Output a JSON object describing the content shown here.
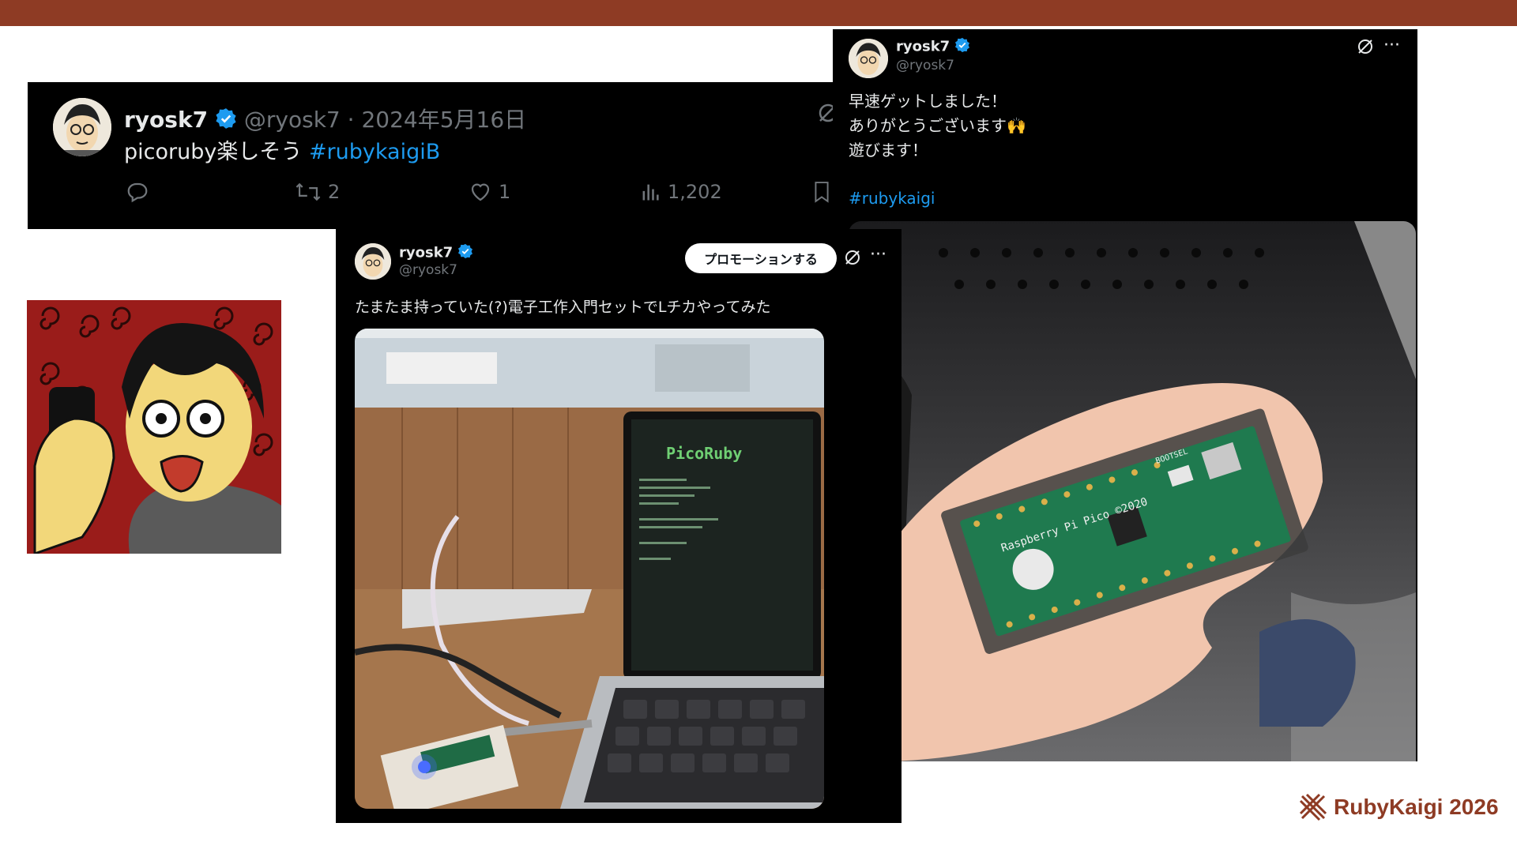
{
  "tweet1": {
    "name": "ryosk7",
    "handle": "@ryosk7",
    "date": "· 2024年5月16日",
    "text": "picoruby楽しそう",
    "hashtag": "#rubykaigiB",
    "reply_count": "",
    "retweet_count": "2",
    "like_count": "1",
    "view_count": "1,202"
  },
  "tweet2": {
    "name": "ryosk7",
    "handle": "@ryosk7",
    "promote_label": "プロモーションする",
    "text": "たまたま持っていた(?)電子工作入門セットでLチカやってみた",
    "screen_logo": "PicoRuby"
  },
  "tweet3": {
    "name": "ryosk7",
    "handle": "@ryosk7",
    "line1": "早速ゲットしました！",
    "line2": "ありがとうございます🙌",
    "line3": "遊びます！",
    "hashtag": "#rubykaigi",
    "board_text": "Raspberry Pi Pico ©2020",
    "bootsel": "BOOTSEL"
  },
  "footer": {
    "brand": "RubyKaigi 2026"
  },
  "colors": {
    "accent_bar": "#8e3b24",
    "card_bg": "#000000",
    "hashtag": "#1d9bf0",
    "muted": "#71767b",
    "portrait_bg": "#9a1c1a"
  }
}
